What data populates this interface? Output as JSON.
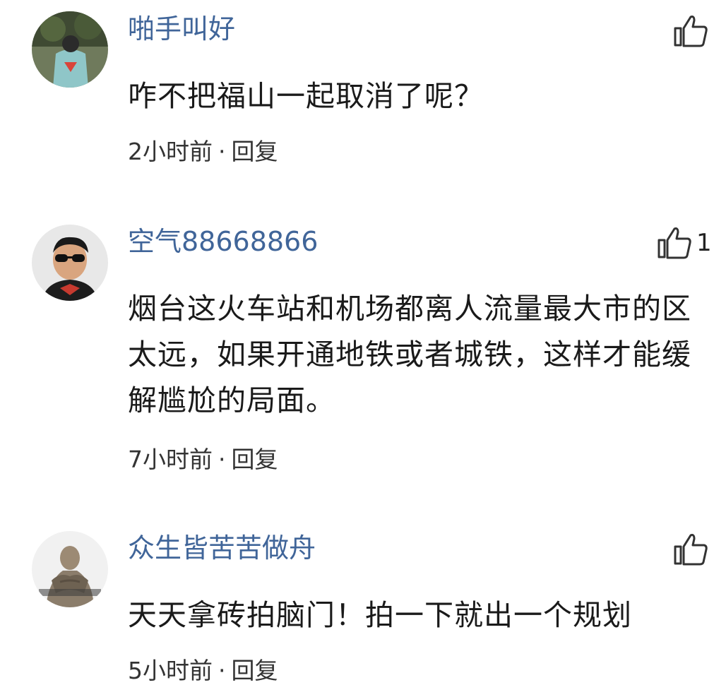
{
  "comments": [
    {
      "username": "啪手叫好",
      "text": "咋不把福山一起取消了呢？",
      "time": "2小时前",
      "separator": "·",
      "reply_label": "回复",
      "like_count": "",
      "avatar_icon": "avatar-superman-shirt"
    },
    {
      "username": "空气88668866",
      "text": "烟台这火车站和机场都离人流量最大市的区太远，如果开通地铁或者城铁，这样才能缓解尴尬的局面。",
      "time": "7小时前",
      "separator": "·",
      "reply_label": "回复",
      "like_count": "1",
      "avatar_icon": "avatar-sunglasses-man"
    },
    {
      "username": "众生皆苦苦做舟",
      "text": "天天拿砖拍脑门！拍一下就出一个规划",
      "time": "5小时前",
      "separator": "·",
      "reply_label": "回复",
      "like_count": "",
      "avatar_icon": "avatar-statue"
    }
  ],
  "colors": {
    "username": "#406599",
    "text": "#1a1a1a",
    "meta": "#333333"
  }
}
